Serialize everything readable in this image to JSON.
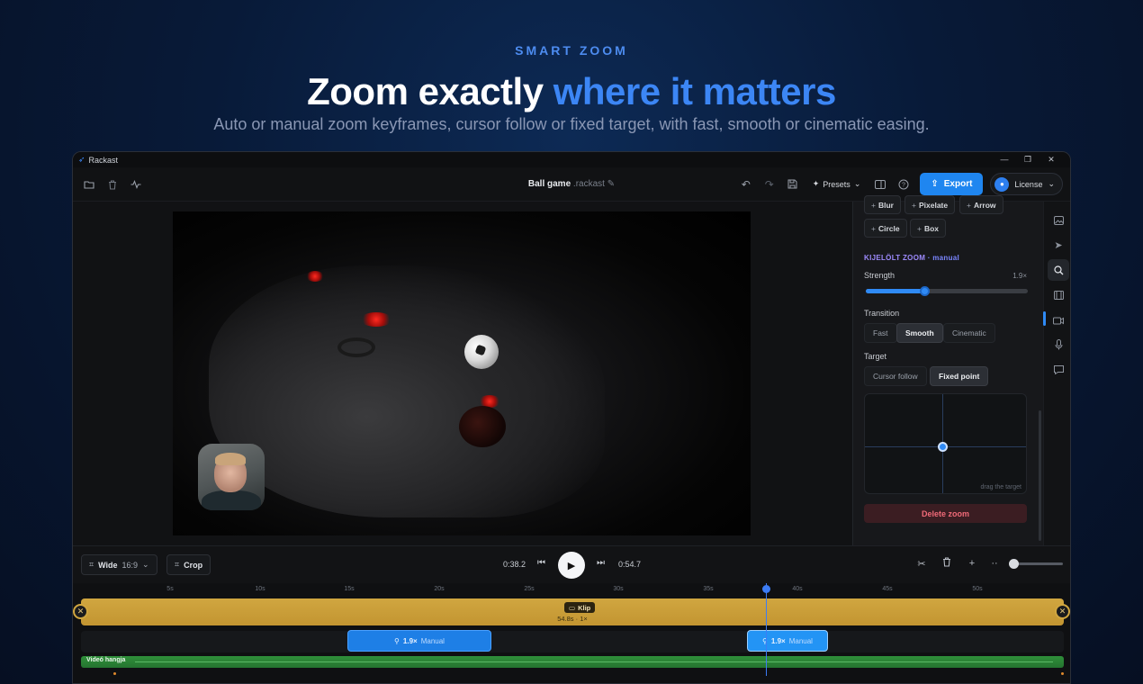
{
  "hero": {
    "eyebrow": "SMART ZOOM",
    "title_main": "Zoom exactly ",
    "title_accent": "where it matters",
    "subtitle": "Auto or manual zoom keyframes, cursor follow or fixed target, with fast, smooth or cinematic easing."
  },
  "window": {
    "app_name": "Rackast",
    "controls": [
      "—",
      "❐",
      "✕"
    ]
  },
  "toolbar": {
    "doc_name": "Ball game",
    "doc_ext": ".rackast",
    "presets_label": "Presets",
    "export_label": "Export",
    "license_label": "License"
  },
  "panel": {
    "effects": [
      "Blur",
      "Pixelate",
      "Arrow",
      "Circle",
      "Box"
    ],
    "zoom_heading": "KIJELÖLT ZOOM",
    "zoom_mode": "· manual",
    "strength_label": "Strength",
    "strength_value": "1.9×",
    "strength_fraction": 0.36,
    "transition_label": "Transition",
    "transition_options": [
      "Fast",
      "Smooth",
      "Cinematic"
    ],
    "transition_selected": "Smooth",
    "target_label": "Target",
    "target_options": [
      "Cursor follow",
      "Fixed point"
    ],
    "target_selected": "Fixed point",
    "target_hint": "drag the target",
    "delete_label": "Delete zoom"
  },
  "rail": {
    "icons": [
      "image-icon",
      "cursor-icon",
      "zoom-icon",
      "film-icon",
      "camera-icon",
      "microphone-icon",
      "comment-icon"
    ],
    "active": "zoom-icon"
  },
  "controls": {
    "aspect_label": "Wide",
    "aspect_ratio": "16:9",
    "crop_label": "Crop",
    "current_time": "0:38.2",
    "total_time": "0:54.7"
  },
  "timeline": {
    "ticks": [
      "5s",
      "10s",
      "15s",
      "20s",
      "25s",
      "30s",
      "35s",
      "40s",
      "45s",
      "50s"
    ],
    "clip_label": "Klip",
    "clip_meta": "54.8s · 1×",
    "zoom_blocks": [
      {
        "strength": "1.9×",
        "mode": "Manual"
      },
      {
        "strength": "1.9×",
        "mode": "Manual"
      }
    ],
    "audio_label": "Videó hangja"
  },
  "colors": {
    "accent": "#3c86f5",
    "export": "#1f86f0",
    "clip": "#d0a640",
    "audio": "#2f8f3a",
    "delete": "#f06a78"
  }
}
